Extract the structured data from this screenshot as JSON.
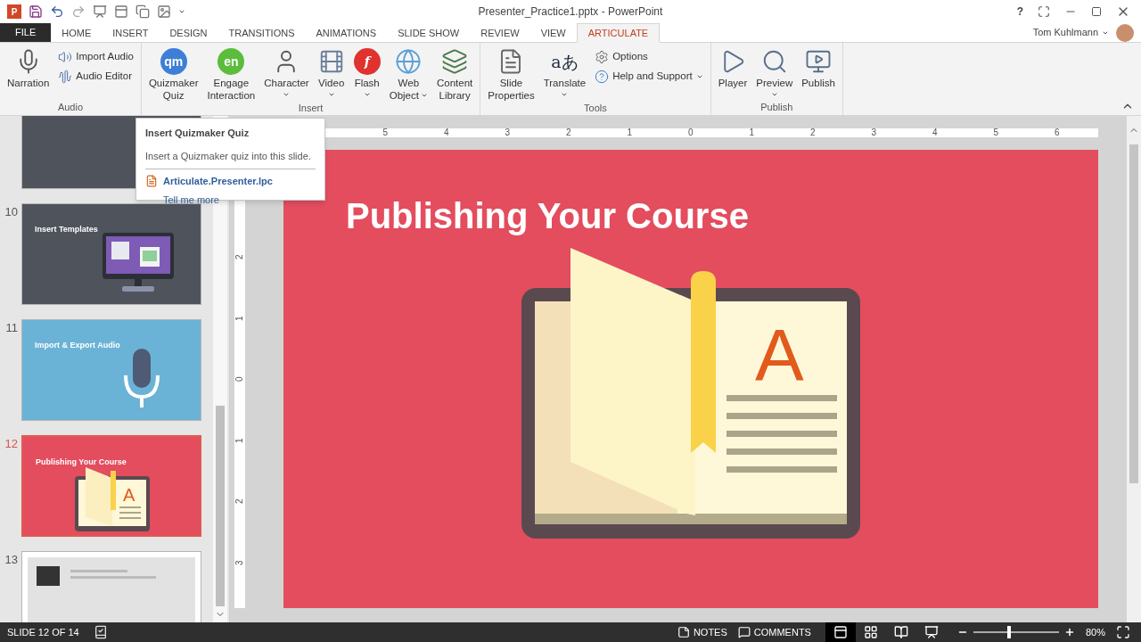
{
  "window": {
    "app_badge": "P",
    "title": "Presenter_Practice1.pptx - PowerPoint",
    "help": "?",
    "user": "Tom Kuhlmann"
  },
  "tabs": [
    {
      "label": "FILE",
      "kind": "file",
      "selected": false
    },
    {
      "label": "HOME",
      "kind": "tab",
      "selected": false
    },
    {
      "label": "INSERT",
      "kind": "tab",
      "selected": false
    },
    {
      "label": "DESIGN",
      "kind": "tab",
      "selected": false
    },
    {
      "label": "TRANSITIONS",
      "kind": "tab",
      "selected": false
    },
    {
      "label": "ANIMATIONS",
      "kind": "tab",
      "selected": false
    },
    {
      "label": "SLIDE SHOW",
      "kind": "tab",
      "selected": false
    },
    {
      "label": "REVIEW",
      "kind": "tab",
      "selected": false
    },
    {
      "label": "VIEW",
      "kind": "tab",
      "selected": false
    },
    {
      "label": "ARTICULATE",
      "kind": "tab",
      "selected": true
    }
  ],
  "ribbon": {
    "groups": [
      {
        "label": "Audio",
        "items": [
          {
            "kind": "large",
            "lines": [
              "Narration"
            ],
            "dropdown": false
          },
          {
            "kind": "small",
            "lines": [
              "Import Audio"
            ],
            "dropdown": false
          },
          {
            "kind": "small",
            "lines": [
              "Audio Editor"
            ],
            "dropdown": false
          }
        ]
      },
      {
        "label": "Insert",
        "items": [
          {
            "kind": "large",
            "lines": [
              "Quizmaker",
              "Quiz"
            ],
            "dropdown": false,
            "glyph": "qm",
            "color": "#3d7fd6"
          },
          {
            "kind": "large",
            "lines": [
              "Engage",
              "Interaction"
            ],
            "dropdown": false,
            "glyph": "en",
            "color": "#5cbd3c"
          },
          {
            "kind": "large",
            "lines": [
              "Character"
            ],
            "dropdown": true
          },
          {
            "kind": "large",
            "lines": [
              "Video"
            ],
            "dropdown": true
          },
          {
            "kind": "large",
            "lines": [
              "Flash"
            ],
            "dropdown": true,
            "glyph": "f",
            "color": "#e0322e"
          },
          {
            "kind": "large",
            "lines": [
              "Web",
              "Object"
            ],
            "dropdown": true
          },
          {
            "kind": "large",
            "lines": [
              "Content",
              "Library"
            ],
            "dropdown": false
          }
        ]
      },
      {
        "label": "Tools",
        "items": [
          {
            "kind": "large",
            "lines": [
              "Slide",
              "Properties"
            ],
            "dropdown": false
          },
          {
            "kind": "large",
            "lines": [
              "Translate"
            ],
            "dropdown": true,
            "glyph": "aあ"
          },
          {
            "kind": "small",
            "lines": [
              "Options"
            ],
            "dropdown": false
          },
          {
            "kind": "small",
            "lines": [
              "Help and Support"
            ],
            "dropdown": true
          }
        ]
      },
      {
        "label": "Publish",
        "items": [
          {
            "kind": "large",
            "lines": [
              "Player"
            ],
            "dropdown": false
          },
          {
            "kind": "large",
            "lines": [
              "Preview"
            ],
            "dropdown": true
          },
          {
            "kind": "large",
            "lines": [
              "Publish"
            ],
            "dropdown": false
          }
        ]
      }
    ]
  },
  "tooltip": {
    "title": "Insert Quizmaker Quiz",
    "description": "Insert a Quizmaker quiz into this slide.",
    "addin": "Articulate.Presenter.lpc",
    "link": "Tell me more"
  },
  "thumbnails": [
    {
      "kind": "dark",
      "selected": false
    },
    {
      "number": "10",
      "kind": "templates",
      "title": "Insert Templates",
      "selected": false
    },
    {
      "number": "11",
      "kind": "audio",
      "title": "Import & Export Audio",
      "selected": false
    },
    {
      "number": "12",
      "kind": "publish",
      "title": "Publishing Your Course",
      "letter": "A",
      "selected": true
    },
    {
      "number": "13",
      "kind": "document",
      "selected": false
    }
  ],
  "ruler": {
    "horizontal": [
      "5",
      "4",
      "3",
      "2",
      "1",
      "0",
      "1",
      "2",
      "3",
      "4",
      "5",
      "6"
    ],
    "vertical": [
      "2",
      "1",
      "0",
      "1",
      "2",
      "3"
    ]
  },
  "slide": {
    "title": "Publishing Your Course",
    "letter": "A"
  },
  "status_bar": {
    "slide": "SLIDE 12 OF 14",
    "notes": "NOTES",
    "comments": "COMMENTS",
    "views": [
      {
        "selected": true
      },
      {
        "selected": false
      },
      {
        "selected": false
      },
      {
        "selected": false
      }
    ],
    "zoom": {
      "level": 0.42,
      "reading": "80%"
    }
  }
}
